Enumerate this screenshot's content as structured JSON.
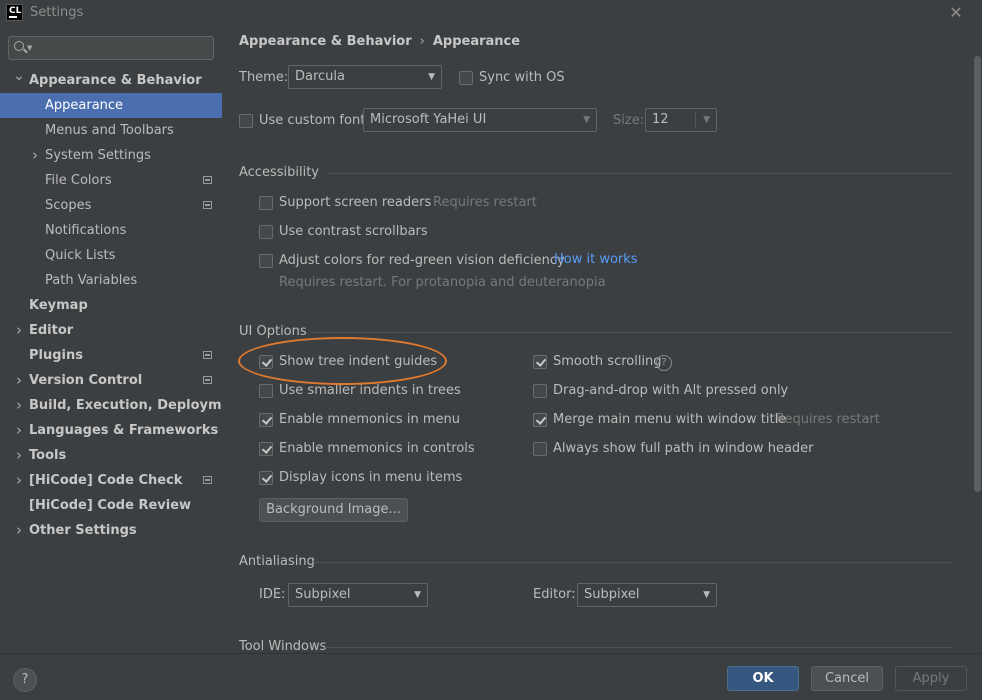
{
  "window": {
    "title": "Settings",
    "logo_text": "CL"
  },
  "search": {
    "placeholder": "",
    "value": ""
  },
  "sidebar": {
    "items": [
      {
        "label": "Appearance & Behavior",
        "bold": true,
        "chevron": "down"
      },
      {
        "label": "Appearance",
        "selected": true
      },
      {
        "label": "Menus and Toolbars"
      },
      {
        "label": "System Settings",
        "chevron": "right"
      },
      {
        "label": "File Colors",
        "project_icon": true
      },
      {
        "label": "Scopes",
        "project_icon": true
      },
      {
        "label": "Notifications"
      },
      {
        "label": "Quick Lists"
      },
      {
        "label": "Path Variables"
      },
      {
        "label": "Keymap",
        "bold": true
      },
      {
        "label": "Editor",
        "bold": true,
        "chevron": "right"
      },
      {
        "label": "Plugins",
        "bold": true,
        "project_icon": true
      },
      {
        "label": "Version Control",
        "bold": true,
        "chevron": "right",
        "project_icon": true
      },
      {
        "label": "Build, Execution, Deployment",
        "bold": true,
        "chevron": "right"
      },
      {
        "label": "Languages & Frameworks",
        "bold": true,
        "chevron": "right"
      },
      {
        "label": "Tools",
        "bold": true,
        "chevron": "right"
      },
      {
        "label": "[HiCode] Code Check",
        "bold": true,
        "chevron": "right",
        "project_icon": true
      },
      {
        "label": "[HiCode] Code Review",
        "bold": true
      },
      {
        "label": "Other Settings",
        "bold": true,
        "chevron": "right"
      }
    ]
  },
  "breadcrumb": {
    "parent": "Appearance & Behavior",
    "separator": "›",
    "current": "Appearance"
  },
  "theme": {
    "label": "Theme:",
    "value": "Darcula",
    "sync_label": "Sync with OS",
    "sync_checked": false
  },
  "font": {
    "custom_label": "Use custom font:",
    "custom_checked": false,
    "value": "Microsoft YaHei UI",
    "size_label": "Size:",
    "size_value": "12"
  },
  "accessibility": {
    "title": "Accessibility",
    "screen_readers": {
      "label": "Support screen readers",
      "note": "Requires restart",
      "checked": false
    },
    "contrast_scrollbars": {
      "label": "Use contrast scrollbars",
      "checked": false
    },
    "red_green": {
      "label": "Adjust colors for red-green vision deficiency",
      "link": "How it works",
      "note": "Requires restart. For protanopia and deuteranopia",
      "checked": false
    }
  },
  "ui_options": {
    "title": "UI Options",
    "left": [
      {
        "label": "Show tree indent guides",
        "checked": true
      },
      {
        "label": "Use smaller indents in trees",
        "checked": false
      },
      {
        "label": "Enable mnemonics in menu",
        "checked": true
      },
      {
        "label": "Enable mnemonics in controls",
        "checked": true
      },
      {
        "label": "Display icons in menu items",
        "checked": true
      }
    ],
    "right": [
      {
        "label": "Smooth scrolling",
        "checked": true,
        "help": "?"
      },
      {
        "label": "Drag-and-drop with Alt pressed only",
        "checked": false
      },
      {
        "label": "Merge main menu with window title",
        "checked": true,
        "note": "Requires restart"
      },
      {
        "label": "Always show full path in window header",
        "checked": false
      }
    ],
    "background_image_button": "Background Image..."
  },
  "antialiasing": {
    "title": "Antialiasing",
    "ide_label": "IDE:",
    "ide_value": "Subpixel",
    "editor_label": "Editor:",
    "editor_value": "Subpixel"
  },
  "tool_windows": {
    "title": "Tool Windows"
  },
  "footer": {
    "help": "?",
    "ok": "OK",
    "cancel": "Cancel",
    "apply": "Apply"
  },
  "colors": {
    "selection": "#4b6eaf",
    "link": "#589df6",
    "annotation": "#e07a2e",
    "ok_button": "#365880"
  }
}
